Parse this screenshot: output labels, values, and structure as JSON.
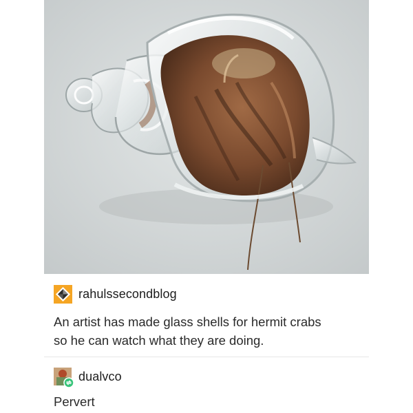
{
  "image": {
    "subject": "hermit-crab-in-glass-shell",
    "colors": {
      "background": "#d3d7d7",
      "crab": "#7a4a2e",
      "glass": "#eef2f2"
    }
  },
  "posts": [
    {
      "username": "rahulssecondblog",
      "avatar_icon": "diamond-logo-icon",
      "text_lines": [
        "An artist has made glass shells for hermit crabs",
        "so he can watch what they are doing."
      ]
    },
    {
      "username": "dualvco",
      "avatar_icon": "reblog-avatar-icon",
      "text_lines": [
        "Pervert"
      ]
    }
  ]
}
